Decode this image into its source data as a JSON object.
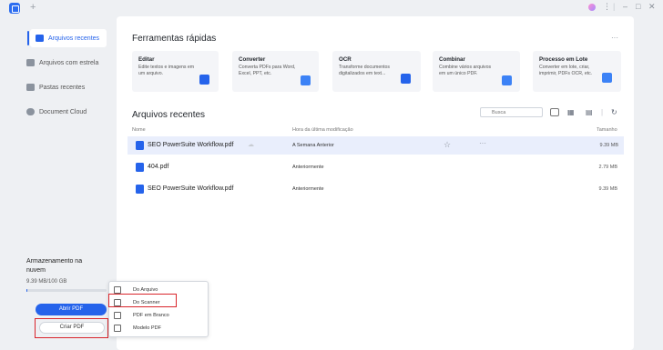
{
  "titlebar": {
    "plus": "+",
    "menu": "⋮",
    "minimize": "–",
    "maximize": "□",
    "close": "✕"
  },
  "sidebar": {
    "items": [
      {
        "label": "Arquivos recentes"
      },
      {
        "label": "Arquivos com estrela"
      },
      {
        "label": "Pastas recentes"
      },
      {
        "label": "Document Cloud"
      }
    ],
    "storage_title": "Armazenamento na nuvem",
    "storage_text": "9.39 MB/100 GB",
    "storage_fraction": 0.0001,
    "open_pdf": "Abrir PDF",
    "create_pdf": "Criar PDF"
  },
  "popup": {
    "items": [
      {
        "label": "Do Arquivo"
      },
      {
        "label": "Do Scanner"
      },
      {
        "label": "PDF em Branco"
      },
      {
        "label": "Modelo PDF"
      }
    ]
  },
  "quick_tools": {
    "title": "Ferramentas rápidas",
    "more": "···",
    "cards": [
      {
        "title": "Editar",
        "desc": "Edite textos e imagens em um arquivo."
      },
      {
        "title": "Converter",
        "desc": "Converta PDFs para Word, Excel, PPT, etc."
      },
      {
        "title": "OCR",
        "desc": "Transforme documentos digitalizados em text..."
      },
      {
        "title": "Combinar",
        "desc": "Combine vários arquivos em um único PDF."
      },
      {
        "title": "Processo em Lote",
        "desc": "Converter em lote, criar, imprimir, PDFs OCR, etc."
      }
    ]
  },
  "recent": {
    "title": "Arquivos recentes",
    "search_placeholder": "Busca",
    "columns": {
      "name": "Nome",
      "modified": "Hora da última modificação",
      "size": "Tamanho"
    },
    "rows": [
      {
        "name": "SEO PowerSuite Workflow.pdf",
        "modified": "A Semana Anterior",
        "size": "9.39 MB"
      },
      {
        "name": "404.pdf",
        "modified": "Anteriormente",
        "size": "2.79 MB"
      },
      {
        "name": "SEO PowerSuite Workflow.pdf",
        "modified": "Anteriormente",
        "size": "9.39 MB"
      }
    ]
  },
  "colors": {
    "accent": "#2563eb",
    "highlight": "#d9242b",
    "selected_row": "#e9eefc"
  }
}
